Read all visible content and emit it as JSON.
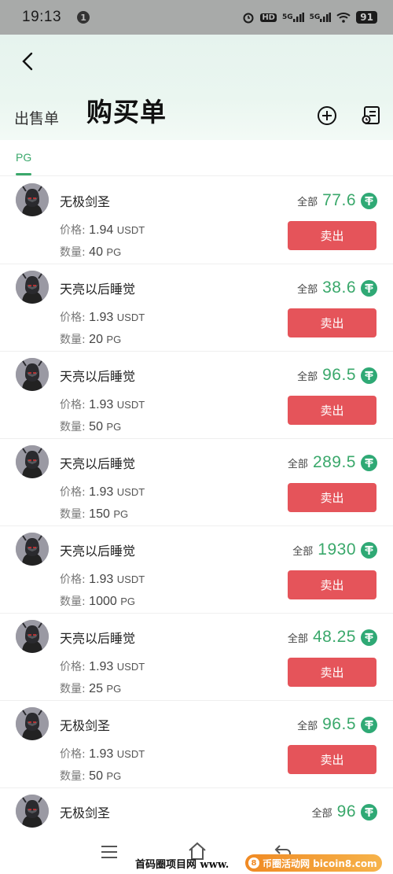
{
  "status_bar": {
    "time": "19:13",
    "notification": "1",
    "hd": "HD",
    "net1": "5G",
    "net2": "5G",
    "battery": "91"
  },
  "header": {
    "sell_tab": "出售单",
    "buy_tab": "购买单"
  },
  "coin_tab": "PG",
  "labels": {
    "price": "价格:",
    "quantity": "数量:",
    "total": "全部",
    "sell_button": "卖出",
    "price_unit": "USDT",
    "qty_unit": "PG"
  },
  "orders": [
    {
      "name": "无极剑圣",
      "price": "1.94",
      "quantity": "40",
      "total": "77.6"
    },
    {
      "name": "天亮以后睡觉",
      "price": "1.93",
      "quantity": "20",
      "total": "38.6"
    },
    {
      "name": "天亮以后睡觉",
      "price": "1.93",
      "quantity": "50",
      "total": "96.5"
    },
    {
      "name": "天亮以后睡觉",
      "price": "1.93",
      "quantity": "150",
      "total": "289.5"
    },
    {
      "name": "天亮以后睡觉",
      "price": "1.93",
      "quantity": "1000",
      "total": "1930"
    },
    {
      "name": "天亮以后睡觉",
      "price": "1.93",
      "quantity": "25",
      "total": "48.25"
    },
    {
      "name": "无极剑圣",
      "price": "1.93",
      "quantity": "50",
      "total": "96.5"
    },
    {
      "name": "无极剑圣",
      "price": "",
      "quantity": "",
      "total": "96"
    }
  ],
  "watermark": {
    "left": "首码圈项目网 www.",
    "right": "币圈活动网 bicoin8.com",
    "badge": "8"
  },
  "colors": {
    "accent": "#3aa86b",
    "sell": "#e5545a",
    "tether": "#2fa975"
  }
}
